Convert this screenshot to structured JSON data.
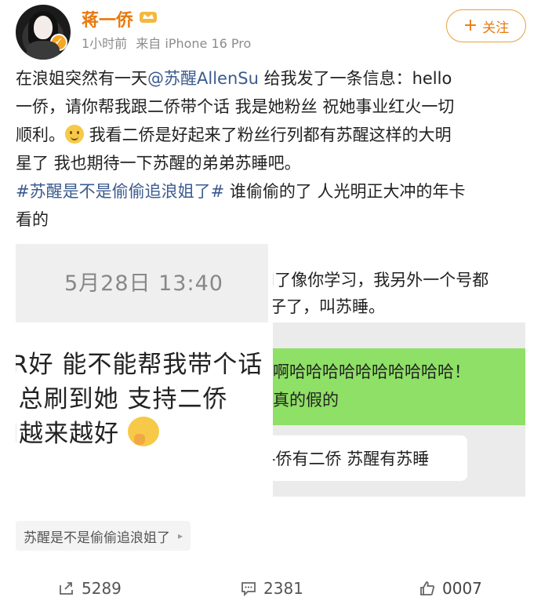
{
  "post": {
    "author": {
      "name": "蒋一侨",
      "time": "1小时前",
      "source": "来自 iPhone 16 Pro",
      "follow_label": "关注"
    },
    "text_lines": [
      {
        "parts": [
          {
            "t": "在浪姐突然有一天"
          },
          {
            "t": "@苏醒AllenSu",
            "link": true
          },
          {
            "t": " 给我发了一条信息：hello"
          }
        ]
      },
      {
        "parts": [
          {
            "t": "一侨，请你帮我跟二侨带个话 我是她粉丝 祝她事业红火一切"
          }
        ]
      },
      {
        "parts": [
          {
            "t": "顺利。"
          },
          {
            "emoji": "smile-emoji"
          },
          {
            "t": " 我看二侨是好起来了粉丝行列都有苏醒这样的大明"
          }
        ]
      },
      {
        "parts": [
          {
            "t": "星了 我也期待一下苏醒的弟弟苏睡吧。"
          }
        ]
      },
      {
        "parts": [
          {
            "t": "#苏醒是不是偷偷追浪姐了#",
            "link": true
          },
          {
            "t": " 谁偷偷的了 人光明正大冲的年卡"
          }
        ]
      },
      {
        "parts": [
          {
            "t": "看的"
          }
        ]
      }
    ],
    "image1": {
      "timestamp": "5月28日 13:40",
      "lines": [
        "R好 能不能帮我带个话",
        "i总刷到她 支持二侨",
        "I越来越好"
      ]
    },
    "image2": {
      "bubble1": [
        "J了像你学习，我另外一个号都",
        "子了，叫苏睡。"
      ],
      "green_bubble": [
        "啊哈哈哈哈哈哈哈哈哈哈！",
        "真的假的"
      ],
      "bubble3": "-侨有二侨 苏醒有苏睡"
    },
    "topic": "苏醒是不是偷偷追浪姐了",
    "footer": {
      "reposts": "5289",
      "comments": "2381",
      "likes": "0007"
    }
  },
  "colors": {
    "username": "#e8790e",
    "link": "#3b5b8f",
    "wechat_green": "#8fe066"
  }
}
